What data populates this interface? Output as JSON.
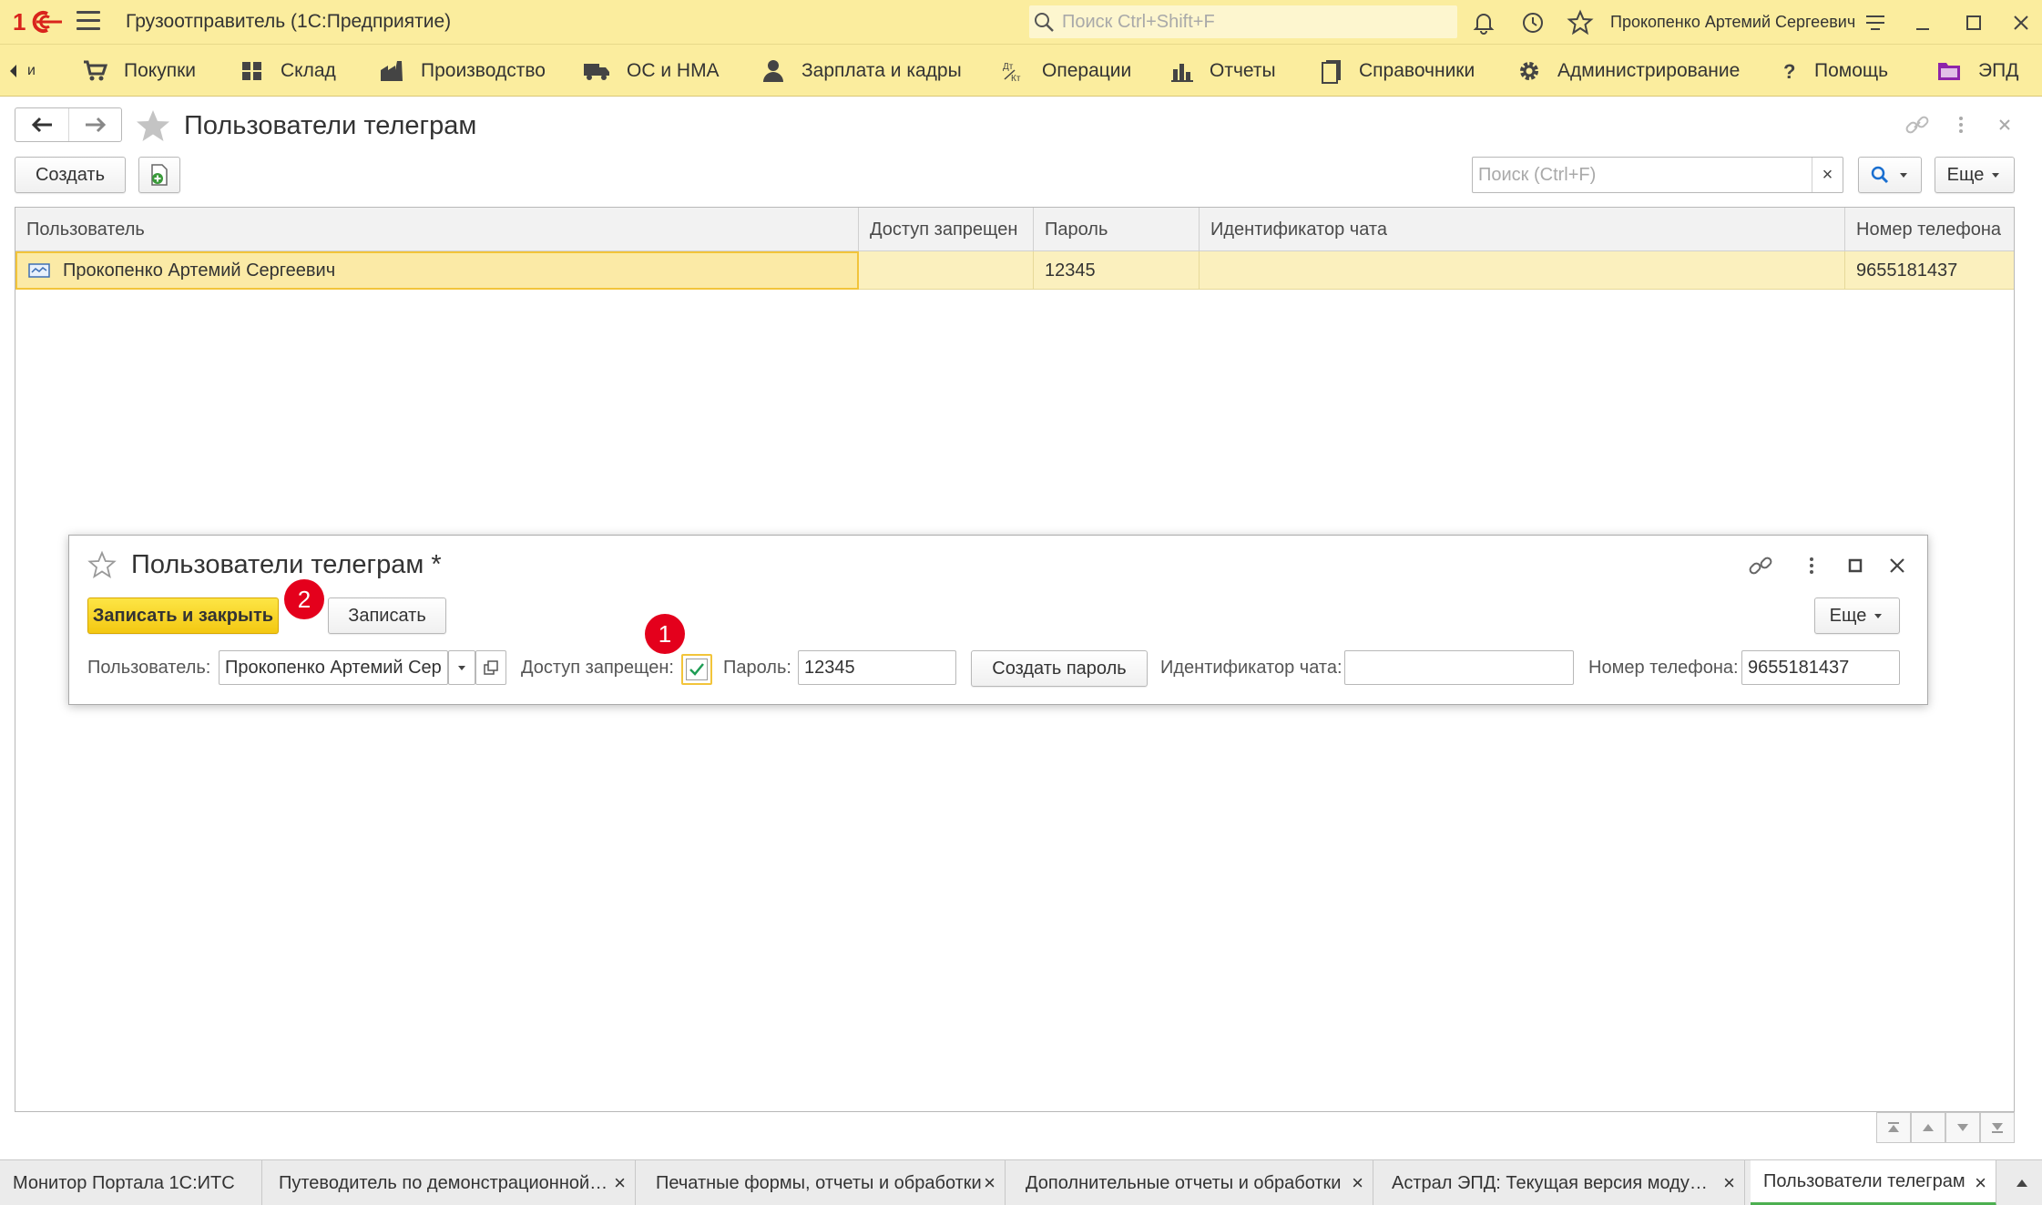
{
  "window": {
    "app_title": "Грузоотправитель  (1С:Предприятие)",
    "search_placeholder": "Поиск Ctrl+Shift+F",
    "user_name": "Прокопенко Артемий Сергеевич"
  },
  "sections": {
    "items": [
      {
        "label": "и",
        "icon": "chevron-left-icon"
      },
      {
        "label": "Покупки",
        "icon": "cart-icon"
      },
      {
        "label": "Склад",
        "icon": "warehouse-icon"
      },
      {
        "label": "Производство",
        "icon": "factory-icon"
      },
      {
        "label": "ОС и НМА",
        "icon": "truck-icon"
      },
      {
        "label": "Зарплата и кадры",
        "icon": "person-icon"
      },
      {
        "label": "Операции",
        "icon": "operations-icon"
      },
      {
        "label": "Отчеты",
        "icon": "bar-chart-icon"
      },
      {
        "label": "Справочники",
        "icon": "book-icon"
      },
      {
        "label": "Администрирование",
        "icon": "gear-icon"
      },
      {
        "label": "Помощь",
        "icon": "question-icon"
      },
      {
        "label": "ЭПД",
        "icon": "folder-icon"
      }
    ]
  },
  "page": {
    "title": "Пользователи телеграм",
    "create_label": "Создать",
    "search_placeholder": "Поиск (Ctrl+F)",
    "search_clear": "×",
    "more_label": "Еще"
  },
  "table": {
    "columns": [
      "Пользователь",
      "Доступ запрещен",
      "Пароль",
      "Идентификатор чата",
      "Номер телефона"
    ],
    "rows": [
      {
        "user": "Прокопенко Артемий Сергеевич",
        "access_denied": "",
        "password": "12345",
        "chat_id": "",
        "phone": "9655181437"
      }
    ]
  },
  "modal": {
    "title": "Пользователи телеграм *",
    "save_close_label": "Записать и закрыть",
    "save_label": "Записать",
    "more_label": "Еще",
    "user_label": "Пользователь:",
    "user_value": "Прокопенко Артемий Сер",
    "access_label": "Доступ запрещен:",
    "access_checked": true,
    "password_label": "Пароль:",
    "password_value": "12345",
    "create_password_label": "Создать пароль",
    "chat_label": "Идентификатор чата:",
    "chat_value": "",
    "phone_label": "Номер телефона:",
    "phone_value": "9655181437",
    "badge_1": "1",
    "badge_2": "2"
  },
  "tabs": [
    {
      "label": "Монитор Портала 1С:ИТС",
      "active": false
    },
    {
      "label": "Путеводитель по демонстрационной…",
      "active": false
    },
    {
      "label": "Печатные формы, отчеты и обработки",
      "active": false
    },
    {
      "label": "Дополнительные отчеты и обработки",
      "active": false
    },
    {
      "label": "Астрал ЭПД: Текущая версия моду…",
      "active": false
    },
    {
      "label": "Пользователи телеграм",
      "active": true
    }
  ],
  "colors": {
    "header_bg": "#fbed9e",
    "selection": "#fbf0be",
    "primary_button": "#f9d71c",
    "badge": "#e4001c",
    "active_tab_underline": "#4caf50"
  }
}
